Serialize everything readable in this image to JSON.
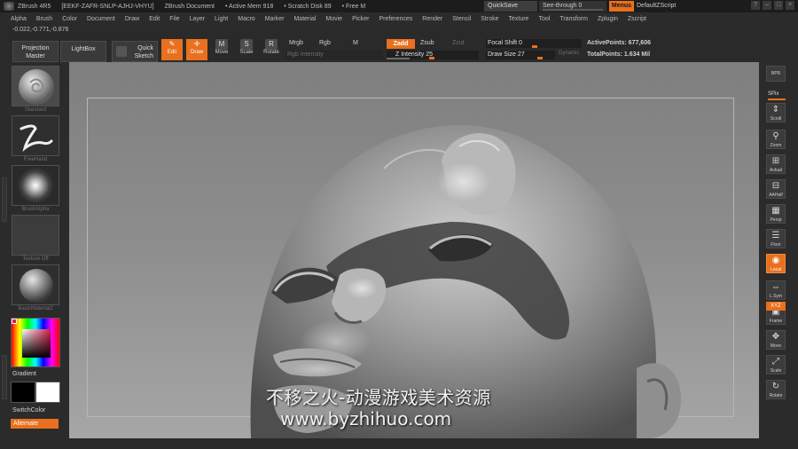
{
  "titlebar": {
    "app": "ZBrush 4R5",
    "serial": "[EEKF-ZAFR-SNLP-AJHJ-VHYU]",
    "document": "ZBrush Document",
    "active_mem": "• Active Mem 918",
    "scratch_disk": "• Scratch Disk 89",
    "free": "• Free M",
    "quicksave": "QuickSave",
    "seethrough": "See-through  0",
    "menus": "Menus",
    "default_script": "DefaultZScript"
  },
  "menubar": [
    "Alpha",
    "Brush",
    "Color",
    "Document",
    "Draw",
    "Edit",
    "File",
    "Layer",
    "Light",
    "Macro",
    "Marker",
    "Material",
    "Movie",
    "Picker",
    "Preferences",
    "Render",
    "Stencil",
    "Stroke",
    "Texture",
    "Tool",
    "Transform",
    "Zplugin",
    "Zscript"
  ],
  "coords": "-0.022,-0.771,-0.876",
  "shelf": {
    "projection_master": [
      "Projection",
      "Master"
    ],
    "lightbox": "LightBox",
    "quick_sketch": [
      "Quick",
      "Sketch"
    ],
    "tools": [
      {
        "label": "Edit",
        "glyph": "✎",
        "active": true
      },
      {
        "label": "Draw",
        "glyph": "✛",
        "active": true
      },
      {
        "label": "Move",
        "glyph": "M",
        "active": false
      },
      {
        "label": "Scale",
        "glyph": "S",
        "active": false
      },
      {
        "label": "Rotate",
        "glyph": "R",
        "active": false
      }
    ],
    "mrgb": "Mrgb",
    "rgb": "Rgb",
    "m": "M",
    "rgb_intensity": "Rgb Intensity",
    "zadd": "Zadd",
    "zsub": "Zsub",
    "zcut": "Zcut",
    "z_intensity": "Z Intensity 25",
    "focal_shift": "Focal Shift 0",
    "draw_size": "Draw Size 27",
    "dynamic": "Dynamic",
    "active_points": "ActivePoints: 677,606",
    "total_points": "TotalPoints: 1.634 Mil"
  },
  "leftpanel": {
    "brush_caption": "Standard",
    "stroke_caption": "FreeHand",
    "alpha_caption": "BrushAlpha",
    "texture_caption": "Texture Off",
    "material_caption": "BasicMaterial2",
    "gradient": "Gradient",
    "switchcolor": "SwitchColor",
    "alternate": "Alternate"
  },
  "rightpanel": {
    "bpr": "BPR",
    "spix": "SPix",
    "buttons": [
      {
        "id": "scroll",
        "label": "Scroll",
        "glyph": "⇕"
      },
      {
        "id": "zoom",
        "label": "Zoom",
        "glyph": "⚲"
      },
      {
        "id": "actual",
        "label": "Actual",
        "glyph": "⊞"
      },
      {
        "id": "aahalf",
        "label": "AAHalf",
        "glyph": "⊟"
      },
      {
        "id": "persp",
        "label": "Persp",
        "glyph": "▦"
      },
      {
        "id": "floor",
        "label": "Floor",
        "glyph": "☰"
      },
      {
        "id": "local",
        "label": "Local",
        "glyph": "◉"
      },
      {
        "id": "lsym",
        "label": "L.Sym",
        "glyph": "⇔"
      },
      {
        "id": "frame",
        "label": "Frame",
        "glyph": "▣"
      },
      {
        "id": "move",
        "label": "Move",
        "glyph": "✥"
      },
      {
        "id": "scale",
        "label": "Scale",
        "glyph": "⤢"
      },
      {
        "id": "rotate",
        "label": "Rotate",
        "glyph": "↻"
      }
    ],
    "xyz": "XYZ"
  },
  "watermark": {
    "line1": "不移之火-动漫游戏美术资源",
    "line2": "www.byzhihuo.com"
  },
  "colors": {
    "accent": "#e8701f",
    "primary_color": "#d6204a"
  }
}
